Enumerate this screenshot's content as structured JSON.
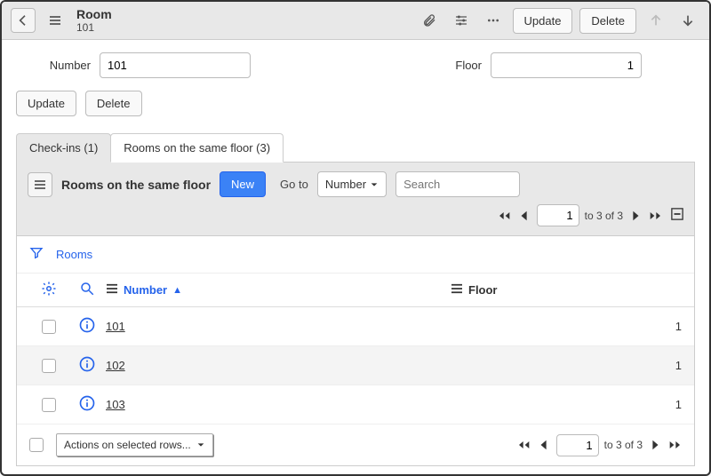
{
  "header": {
    "title": "Room",
    "subtitle": "101",
    "update_label": "Update",
    "delete_label": "Delete"
  },
  "form": {
    "number_label": "Number",
    "number_value": "101",
    "floor_label": "Floor",
    "floor_value": "1",
    "update_label": "Update",
    "delete_label": "Delete"
  },
  "tabs": {
    "checkins_label": "Check-ins (1)",
    "rooms_label": "Rooms on the same floor (3)"
  },
  "panel": {
    "title": "Rooms on the same floor",
    "new_label": "New",
    "goto_label": "Go to",
    "goto_field": "Number",
    "search_placeholder": "Search",
    "page_value": "1",
    "page_range": "to 3 of 3"
  },
  "filter": {
    "rooms_link": "Rooms"
  },
  "columns": {
    "number": "Number",
    "floor": "Floor"
  },
  "rows": [
    {
      "number": "101",
      "floor": "1"
    },
    {
      "number": "102",
      "floor": "1"
    },
    {
      "number": "103",
      "floor": "1"
    }
  ],
  "footer": {
    "actions_label": "Actions on selected rows...",
    "page_value": "1",
    "page_range": "to 3 of 3"
  }
}
